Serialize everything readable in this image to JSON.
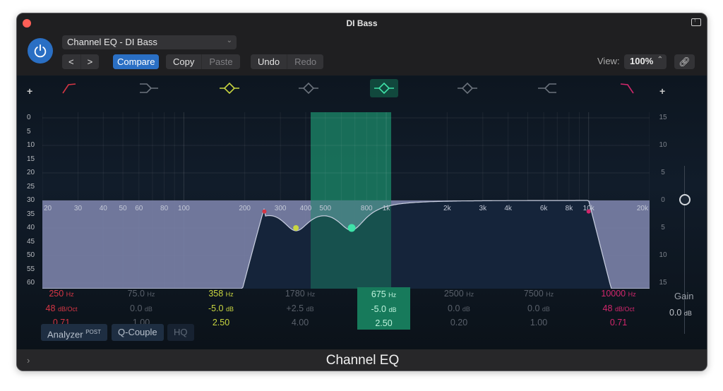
{
  "window": {
    "title": "DI Bass",
    "footer_title": "Channel EQ"
  },
  "toolbar": {
    "preset": "Channel EQ - DI Bass",
    "prev": "<",
    "next": ">",
    "compare": "Compare",
    "copy": "Copy",
    "paste": "Paste",
    "undo": "Undo",
    "redo": "Redo",
    "view_label": "View:",
    "view_value": "100%"
  },
  "eq": {
    "db_scale_left": [
      "0",
      "5",
      "10",
      "15",
      "20",
      "25",
      "30",
      "35",
      "40",
      "45",
      "50",
      "55",
      "60"
    ],
    "db_scale_right": [
      "15",
      "10",
      "5",
      "0",
      "5",
      "10",
      "15"
    ],
    "freq_labels": [
      "20",
      "30",
      "40",
      "50",
      "60",
      "80",
      "100",
      "200",
      "300",
      "400",
      "500",
      "800",
      "1k",
      "2k",
      "3k",
      "4k",
      "6k",
      "8k",
      "10k",
      "20k"
    ],
    "bands": [
      {
        "type": "low-cut",
        "color": "#d63645",
        "active": true,
        "selected": false,
        "freq": "250",
        "freq_unit": "Hz",
        "gain": "48",
        "gain_unit": "dB/Oct",
        "q": "0.71"
      },
      {
        "type": "low-shelf",
        "color": "#6c737d",
        "active": false,
        "selected": false,
        "freq": "75.0",
        "freq_unit": "Hz",
        "gain": "0.0",
        "gain_unit": "dB",
        "q": "1.00"
      },
      {
        "type": "bell",
        "color": "#c9d640",
        "active": true,
        "selected": false,
        "freq": "358",
        "freq_unit": "Hz",
        "gain": "-5.0",
        "gain_unit": "dB",
        "q": "2.50"
      },
      {
        "type": "bell",
        "color": "#6c737d",
        "active": false,
        "selected": false,
        "freq": "1780",
        "freq_unit": "Hz",
        "gain": "+2.5",
        "gain_unit": "dB",
        "q": "4.00"
      },
      {
        "type": "bell",
        "color": "#3fe3a9",
        "active": true,
        "selected": true,
        "freq": "675",
        "freq_unit": "Hz",
        "gain": "-5.0",
        "gain_unit": "dB",
        "q": "2.50"
      },
      {
        "type": "bell",
        "color": "#6c737d",
        "active": false,
        "selected": false,
        "freq": "2500",
        "freq_unit": "Hz",
        "gain": "0.0",
        "gain_unit": "dB",
        "q": "0.20"
      },
      {
        "type": "high-shelf",
        "color": "#6c737d",
        "active": false,
        "selected": false,
        "freq": "7500",
        "freq_unit": "Hz",
        "gain": "0.0",
        "gain_unit": "dB",
        "q": "1.00"
      },
      {
        "type": "high-cut",
        "color": "#d2276c",
        "active": true,
        "selected": false,
        "freq": "10000",
        "freq_unit": "Hz",
        "gain": "48",
        "gain_unit": "dB/Oct",
        "q": "0.71"
      }
    ],
    "gain_label": "Gain",
    "gain_value": "0.0",
    "gain_unit": "dB",
    "gain_level_db": 0
  },
  "options": {
    "analyzer": "Analyzer",
    "analyzer_mode": "POST",
    "q_couple": "Q-Couple",
    "hq": "HQ"
  }
}
